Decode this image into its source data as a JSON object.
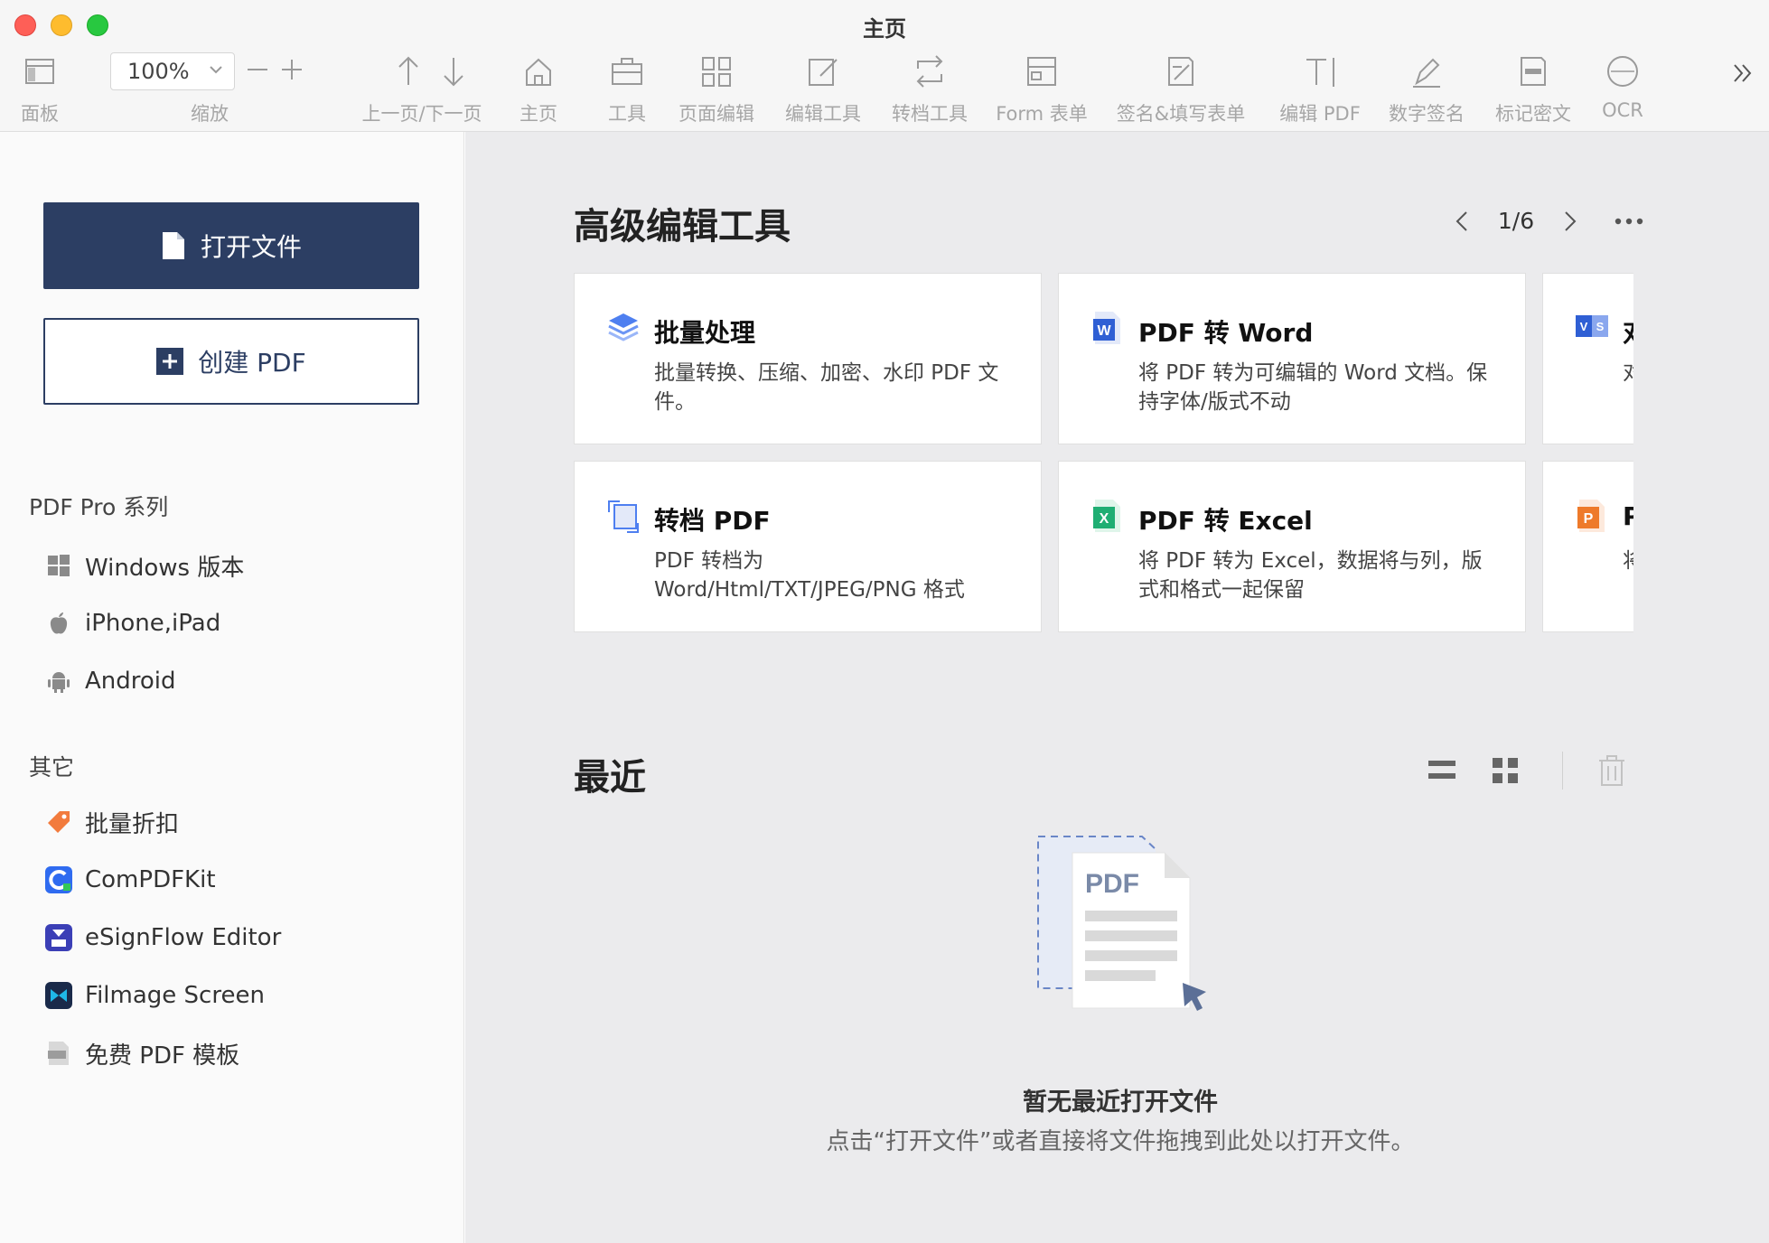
{
  "window": {
    "title": "主页"
  },
  "toolbar": {
    "items": [
      {
        "label": "面板",
        "icon": "panel-icon"
      },
      {
        "label": "缩放",
        "icon": "zoom-icon"
      },
      {
        "label": "上一页/下一页",
        "icon": "page-nav-icon"
      },
      {
        "label": "主页",
        "icon": "home-icon"
      },
      {
        "label": "工具",
        "icon": "toolbox-icon"
      },
      {
        "label": "页面编辑",
        "icon": "grid-icon"
      },
      {
        "label": "编辑工具",
        "icon": "edit-icon"
      },
      {
        "label": "转档工具",
        "icon": "convert-icon"
      },
      {
        "label": "Form 表单",
        "icon": "form-icon"
      },
      {
        "label": "签名&填写表单",
        "icon": "sign-fill-icon"
      },
      {
        "label": "编辑 PDF",
        "icon": "text-edit-icon"
      },
      {
        "label": "数字签名",
        "icon": "pen-icon"
      },
      {
        "label": "标记密文",
        "icon": "redact-icon"
      },
      {
        "label": "OCR",
        "icon": "ocr-icon"
      }
    ],
    "zoom_value": "100%"
  },
  "sidebar": {
    "open_file": "打开文件",
    "create_pdf": "创建 PDF",
    "pro_section": "PDF Pro 系列",
    "pro_items": [
      {
        "label": "Windows 版本",
        "icon": "windows-icon"
      },
      {
        "label": "iPhone,iPad",
        "icon": "apple-icon"
      },
      {
        "label": "Android",
        "icon": "android-icon"
      }
    ],
    "other_section": "其它",
    "other_items": [
      {
        "label": "批量折扣",
        "icon": "discount-tag-icon"
      },
      {
        "label": "ComPDFKit",
        "icon": "compdfkit-icon"
      },
      {
        "label": "eSignFlow Editor",
        "icon": "esignflow-icon"
      },
      {
        "label": "Filmage Screen",
        "icon": "filmage-icon"
      },
      {
        "label": "免费 PDF 模板",
        "icon": "pdf-template-icon"
      }
    ]
  },
  "advanced": {
    "title": "高级编辑工具",
    "page": "1/6",
    "cards": [
      {
        "title": "批量处理",
        "desc": "批量转换、压缩、加密、水印 PDF 文件。",
        "icon": "layers-icon"
      },
      {
        "title": "PDF 转 Word",
        "desc": "将 PDF 转为可编辑的 Word 文档。保持字体/版式不动",
        "icon": "word-icon"
      },
      {
        "title": "对",
        "desc": "对",
        "icon": "compare-icon"
      },
      {
        "title": "转档 PDF",
        "desc": "PDF 转档为 Word/Html/TXT/JPEG/PNG 格式",
        "icon": "convert-pdf-icon"
      },
      {
        "title": "PDF 转 Excel",
        "desc": "将 PDF 转为 Excel，数据将与列，版式和格式一起保留",
        "icon": "excel-icon"
      },
      {
        "title": "P",
        "desc": "将 村",
        "icon": "ppt-icon"
      }
    ]
  },
  "recent": {
    "title": "最近",
    "empty_title": "暂无最近打开文件",
    "empty_desc": "点击“打开文件”或者直接将文件拖拽到此处以打开文件。",
    "illus_text": "PDF"
  },
  "colors": {
    "primary": "#2c3e63",
    "bg_main": "#ebebed",
    "toolbar_icon": "#9a9a9a"
  }
}
